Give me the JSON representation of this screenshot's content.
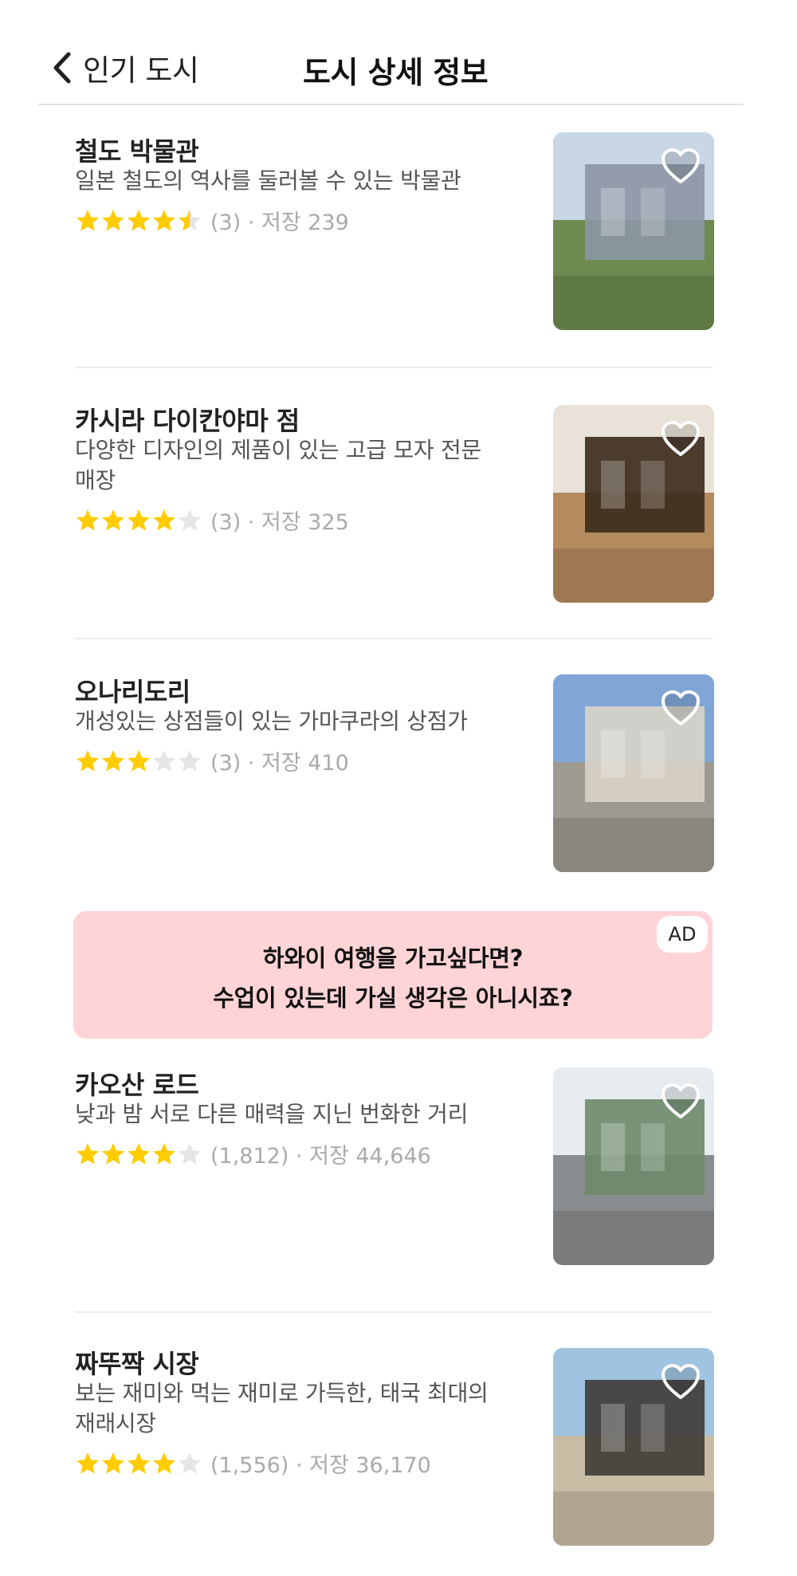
{
  "header": {
    "back_label": "인기 도시",
    "title": "도시 상세 정보"
  },
  "items": [
    {
      "title": "철도 박물관",
      "desc": "일본 철도의 역사를 둘러볼 수 있는 박물관",
      "rating": 4.5,
      "meta": "(3) · 저장 239",
      "image": "railway-museum-photo",
      "colors": {
        "sky": "#c9d6e6",
        "main": "#8c96a4",
        "ground": "#6d8a4f"
      }
    },
    {
      "title": "카시라 다이칸야마 점",
      "desc": "다양한 디자인의 제품이 있는 고급 모자 전문 매장",
      "rating": 4,
      "meta": "(3) · 저장 325",
      "image": "hat-store-photo",
      "colors": {
        "sky": "#e8e2d8",
        "main": "#3a2a1c",
        "ground": "#b48a5f"
      }
    },
    {
      "title": "오나리도리",
      "desc": "개성있는 상점들이 있는 가마쿠라의 상점가",
      "rating": 3,
      "meta": "(3) · 저장 410",
      "image": "shopping-street-photo",
      "colors": {
        "sky": "#7fa6d6",
        "main": "#d9d4c8",
        "ground": "#9e9a92"
      }
    },
    {
      "title": "카오산 로드",
      "desc": "낮과 밤 서로 다른 매력을 지닌 번화한 거리",
      "rating": 4,
      "meta": "(1,812) · 저장 44,646",
      "image": "khaosan-road-photo",
      "colors": {
        "sky": "#e6ecef",
        "main": "#6b8a6a",
        "ground": "#8a8d8f"
      }
    },
    {
      "title": "짜뚜짝 시장",
      "desc": "보는 재미와 먹는 재미로 가득한, 태국 최대의 재래시장",
      "rating": 4,
      "meta": "(1,556) · 저장 36,170",
      "image": "chatuchak-market-photo",
      "colors": {
        "sky": "#9fc3e0",
        "main": "#3f3a36",
        "ground": "#c9bca4"
      }
    }
  ],
  "ad": {
    "badge": "AD",
    "line1": "하와이 여행을 가고싶다면?",
    "line2": "수업이 있는데 가실 생각은 아니시죠?"
  },
  "colors": {
    "star_filled": "#ffcc00",
    "star_empty": "#e5e5e5",
    "ad_background": "#ffd4d6"
  }
}
